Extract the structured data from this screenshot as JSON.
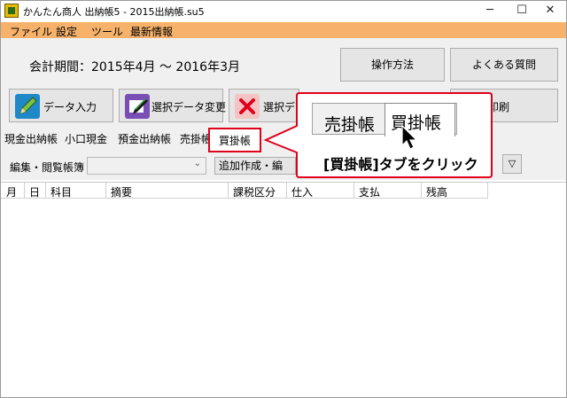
{
  "window": {
    "title": "かんたん商人 出納帳5 - 2015出納帳.su5",
    "minimize_glyph": "─",
    "maximize_glyph": "☐",
    "close_glyph": "✕"
  },
  "menu": {
    "items": [
      "ファイル",
      "設定",
      "ツール",
      "最新情報"
    ]
  },
  "period_label": "会計期間：2015年4月 〜 2016年3月",
  "top_buttons": {
    "howto": "操作方法",
    "faq": "よくある質問"
  },
  "toolbar_buttons": {
    "data_entry": "データ入力",
    "change_selected": "選択データ変更",
    "delete_selected": "選択デ",
    "print": "印刷"
  },
  "tabs": [
    "現金出納帳",
    "小口現金",
    "預金出納帳",
    "売掛帳",
    "買掛帳"
  ],
  "ledger_bar": {
    "label": "編集・閲覧帳簿",
    "select_value": "",
    "add_button": "追加作成・編",
    "small_button_glyph": "▽"
  },
  "columns": [
    "月",
    "日",
    "科目",
    "摘要",
    "課税区分",
    "仕入",
    "支払",
    "残高"
  ],
  "callout": {
    "inactive_tab": "売掛帳",
    "active_tab": "買掛帳",
    "instruction": "[買掛帳]タブをクリック"
  },
  "icons": {
    "app": "app-logo-icon",
    "pencil": "pencil-icon",
    "edit": "edit-data-icon",
    "delete": "red-x-icon",
    "cursor": "mouse-pointer-icon"
  },
  "colors": {
    "menu_bg": "#f6b26b",
    "highlight": "#e0001b"
  }
}
